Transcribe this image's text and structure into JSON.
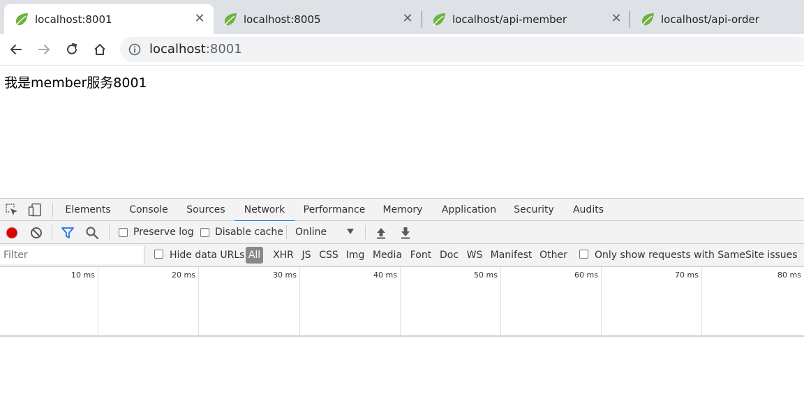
{
  "browser": {
    "tabs": [
      {
        "title": "localhost:8001",
        "active": true
      },
      {
        "title": "localhost:8005",
        "active": false
      },
      {
        "title": "localhost/api-member",
        "active": false
      },
      {
        "title": "localhost/api-order",
        "active": false
      }
    ],
    "address": {
      "host": "localhost",
      "port": ":8001"
    },
    "colors": {
      "leaf": "#6db33f",
      "accent": "#1a73e8",
      "record": "#e00000"
    }
  },
  "page": {
    "body_text": "我是member服务8001"
  },
  "devtools": {
    "tabs": [
      "Elements",
      "Console",
      "Sources",
      "Network",
      "Performance",
      "Memory",
      "Application",
      "Security",
      "Audits"
    ],
    "active_tab": "Network",
    "toolbar": {
      "preserve_log": "Preserve log",
      "disable_cache": "Disable cache",
      "throttling": "Online"
    },
    "filterbar": {
      "filter_placeholder": "Filter",
      "hide_data_urls": "Hide data URLs",
      "types": [
        "All",
        "XHR",
        "JS",
        "CSS",
        "Img",
        "Media",
        "Font",
        "Doc",
        "WS",
        "Manifest",
        "Other"
      ],
      "active_type": "All",
      "samesite": "Only show requests with SameSite issues"
    },
    "timeline_ticks": [
      "10 ms",
      "20 ms",
      "30 ms",
      "40 ms",
      "50 ms",
      "60 ms",
      "70 ms",
      "80 ms"
    ]
  }
}
